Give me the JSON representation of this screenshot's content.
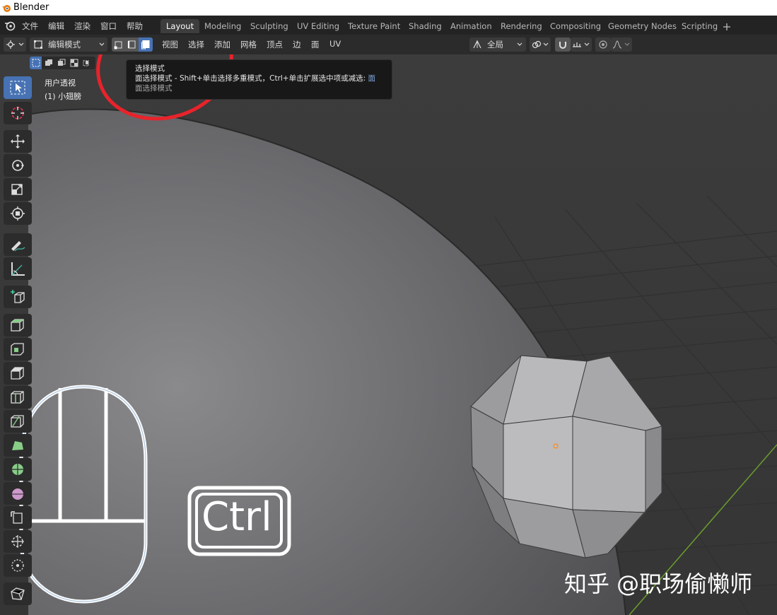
{
  "window": {
    "title": "Blender"
  },
  "menu": [
    "文件",
    "编辑",
    "渲染",
    "窗口",
    "帮助"
  ],
  "workspace_tabs": [
    "Layout",
    "Modeling",
    "Sculpting",
    "UV Editing",
    "Texture Paint",
    "Shading",
    "Animation",
    "Rendering",
    "Compositing",
    "Geometry Nodes",
    "Scripting"
  ],
  "active_tab": "Layout",
  "header": {
    "mode": "编辑模式",
    "menus": [
      "视图",
      "选择",
      "添加",
      "网格",
      "顶点",
      "边",
      "面",
      "UV"
    ],
    "transform_orientation": "全局",
    "select_modes": [
      "vertex-select-icon",
      "edge-select-icon",
      "face-select-icon"
    ],
    "active_select_mode": "face"
  },
  "viewport": {
    "view_name": "用户透视",
    "object_name": "(1) 小翅膀"
  },
  "tooltip": {
    "title": "选择模式",
    "description": "面选择模式 - Shift+单击选择多重模式，Ctrl+单击扩展选中项或减选:",
    "description_tail": "面",
    "subtitle": "面选择模式"
  },
  "overlay": {
    "key_label": "Ctrl",
    "watermark": "知乎 @职场偷懒师",
    "highlight_color": "#e8232b"
  },
  "colors": {
    "accent": "#4772b3",
    "background": "#3d3d3d",
    "topbar": "#232323"
  }
}
